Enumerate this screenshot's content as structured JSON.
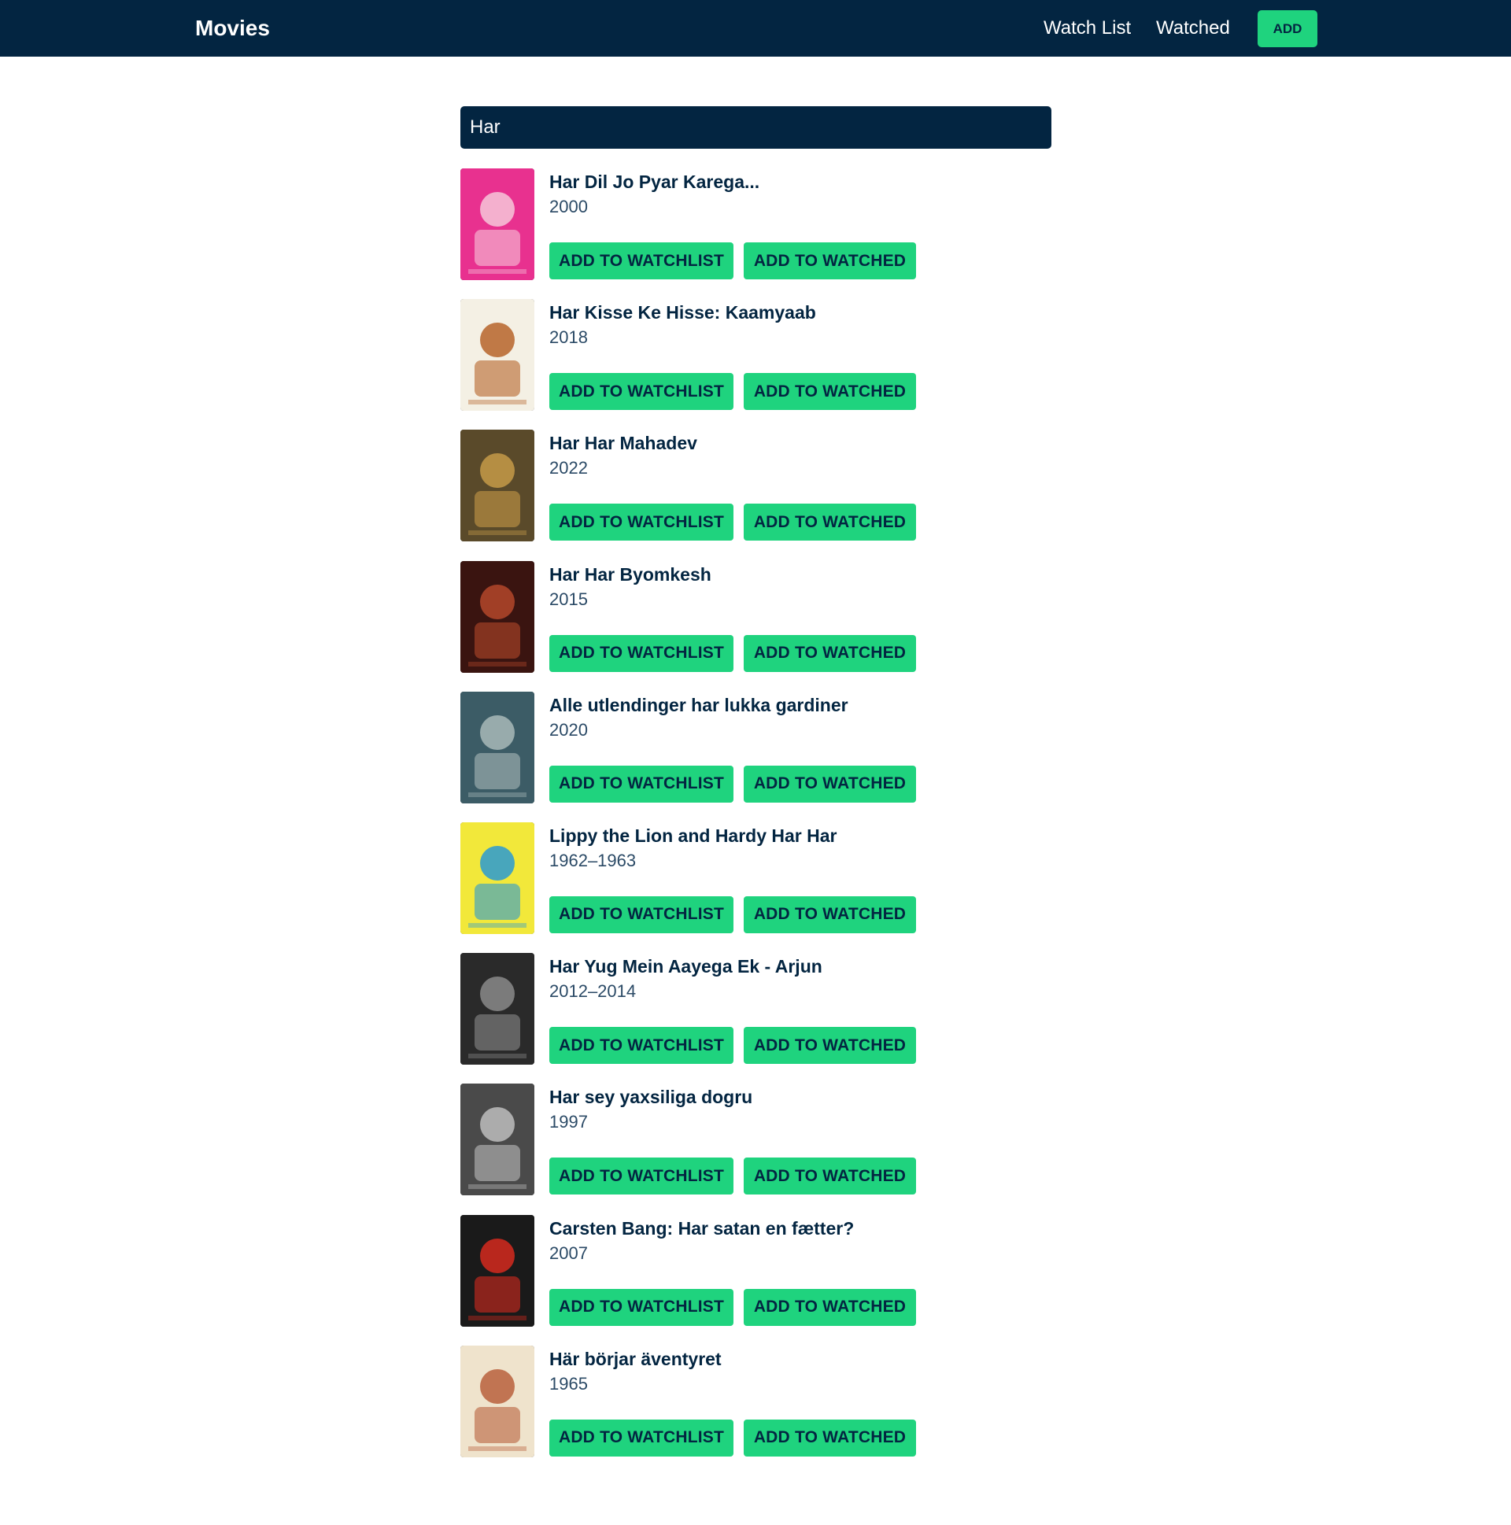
{
  "navbar": {
    "brand": "Movies",
    "links": {
      "watch_list": "Watch List",
      "watched": "Watched",
      "add": "ADD"
    }
  },
  "search": {
    "value": "Har"
  },
  "buttons": {
    "add_to_watchlist": "ADD TO WATCHLIST",
    "add_to_watched": "ADD TO WATCHED"
  },
  "results": [
    {
      "title": "Har Dil Jo Pyar Karega...",
      "year": "2000"
    },
    {
      "title": "Har Kisse Ke Hisse: Kaamyaab",
      "year": "2018"
    },
    {
      "title": "Har Har Mahadev",
      "year": "2022"
    },
    {
      "title": "Har Har Byomkesh",
      "year": "2015"
    },
    {
      "title": "Alle utlendinger har lukka gardiner",
      "year": "2020"
    },
    {
      "title": "Lippy the Lion and Hardy Har Har",
      "year": "1962–1963"
    },
    {
      "title": "Har Yug Mein Aayega Ek - Arjun",
      "year": "2012–2014"
    },
    {
      "title": "Har sey yaxsiliga dogru",
      "year": "1997"
    },
    {
      "title": "Carsten Bang: Har satan en fætter?",
      "year": "2007"
    },
    {
      "title": "Här börjar äventyret",
      "year": "1965"
    }
  ],
  "posters": [
    {
      "icon": "poster-image-icon",
      "bg": "#e8318f",
      "fg": "#f6c7d9"
    },
    {
      "icon": "poster-image-icon",
      "bg": "#f4f0e4",
      "fg": "#b6642a"
    },
    {
      "icon": "poster-image-icon",
      "bg": "#5a4a2a",
      "fg": "#c69a48"
    },
    {
      "icon": "poster-image-icon",
      "bg": "#3a1410",
      "fg": "#b4472a"
    },
    {
      "icon": "poster-image-icon",
      "bg": "#3c5c66",
      "fg": "#a8b8b8"
    },
    {
      "icon": "poster-image-icon",
      "bg": "#f2e83a",
      "fg": "#2a9ad4"
    },
    {
      "icon": "poster-image-icon",
      "bg": "#2a2a2a",
      "fg": "#8a8a8a"
    },
    {
      "icon": "poster-image-icon",
      "bg": "#4a4a4a",
      "fg": "#bdbdbd"
    },
    {
      "icon": "poster-image-icon",
      "bg": "#1a1a1a",
      "fg": "#d62a1e"
    },
    {
      "icon": "poster-image-icon",
      "bg": "#efe3cc",
      "fg": "#b8603c"
    }
  ],
  "colors": {
    "navbar_bg": "#032541",
    "accent": "#1fd37e",
    "text_primary": "#032541"
  }
}
